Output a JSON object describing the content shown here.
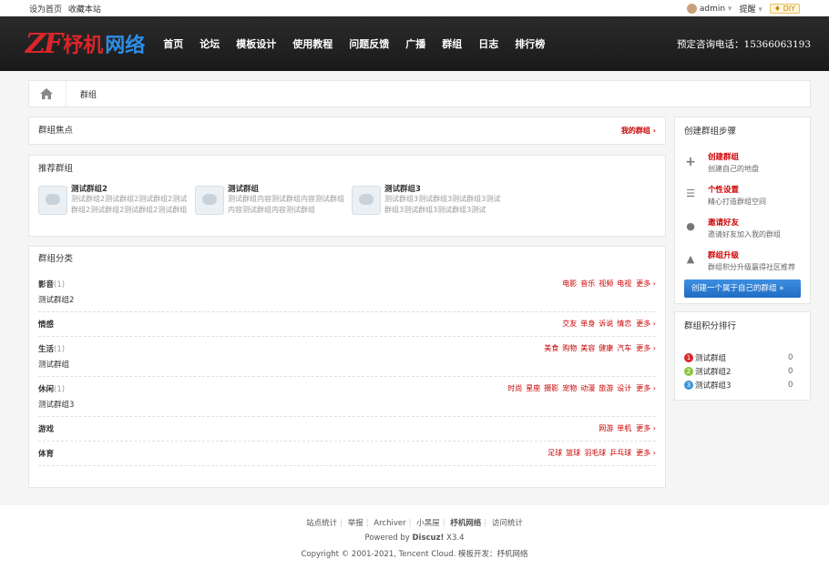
{
  "topbar": {
    "set_home": "设为首页",
    "bookmark": "收藏本站",
    "user": "admin",
    "remind": "提醒",
    "diy": "DIY"
  },
  "header": {
    "logo_letters": "ZF",
    "logo_text1": "杼机",
    "logo_text2": "网络",
    "nav": [
      "首页",
      "论坛",
      "模板设计",
      "使用教程",
      "问题反馈",
      "广播",
      "群组",
      "日志",
      "排行榜"
    ],
    "hotline": "预定咨询电话：15366063193"
  },
  "breadcrumb": {
    "current": "群组"
  },
  "focus": {
    "title": "群组焦点",
    "my_groups": "我的群组 ›"
  },
  "recommend": {
    "title": "推荐群组",
    "groups": [
      {
        "name": "测试群组2",
        "desc": "测试群组2测试群组2测试群组2测试群组2测试群组2测试群组2测试群组2"
      },
      {
        "name": "测试群组",
        "desc": "测试群组内容测试群组内容测试群组内容测试群组内容测试群组"
      },
      {
        "name": "测试群组3",
        "desc": "测试群组3测试群组3测试群组3测试群组3测试群组3测试群组3测试"
      }
    ]
  },
  "categories": {
    "title": "群组分类",
    "items": [
      {
        "name": "影音",
        "count": "(1)",
        "links": [
          "电影",
          "音乐",
          "视频",
          "电视"
        ],
        "more": "更多 ›",
        "sub": "测试群组2"
      },
      {
        "name": "情感",
        "count": "",
        "links": [
          "交友",
          "单身",
          "诉说",
          "情恋"
        ],
        "more": "更多 ›",
        "sub": ""
      },
      {
        "name": "生活",
        "count": "(1)",
        "links": [
          "美食",
          "购物",
          "美容",
          "健康",
          "汽车"
        ],
        "more": "更多 ›",
        "sub": "测试群组"
      },
      {
        "name": "休闲",
        "count": "(1)",
        "links": [
          "时尚",
          "星座",
          "摄影",
          "宠物",
          "动漫",
          "旅游",
          "设计"
        ],
        "more": "更多 ›",
        "sub": "测试群组3"
      },
      {
        "name": "游戏",
        "count": "",
        "links": [
          "网游",
          "单机"
        ],
        "more": "更多 ›",
        "sub": ""
      },
      {
        "name": "体育",
        "count": "",
        "links": [
          "足球",
          "篮球",
          "羽毛球",
          "乒乓球"
        ],
        "more": "更多 ›",
        "sub": ""
      }
    ]
  },
  "steps": {
    "title": "创建群组步骤",
    "items": [
      {
        "icon": "plus-icon",
        "title": "创建群组",
        "desc": "创建自己的地盘"
      },
      {
        "icon": "list-icon",
        "title": "个性设置",
        "desc": "精心打造群组空间"
      },
      {
        "icon": "user-icon",
        "title": "邀请好友",
        "desc": "邀请好友加入我的群组"
      },
      {
        "icon": "arrow-up-icon",
        "title": "群组升级",
        "desc": "群组积分升级赢得社区推荐"
      }
    ],
    "button": "创建一个属于自己的群组 »"
  },
  "ranking": {
    "title": "群组积分排行",
    "items": [
      {
        "no": "1",
        "name": "测试群组",
        "value": "0",
        "color": "#d9262b"
      },
      {
        "no": "2",
        "name": "测试群组2",
        "value": "0",
        "color": "#8cc63f"
      },
      {
        "no": "3",
        "name": "测试群组3",
        "value": "0",
        "color": "#3a95d8"
      }
    ]
  },
  "footer": {
    "links": [
      "站点统计",
      "举报",
      "Archiver",
      "小黑屋",
      "杼机网络",
      "访问统计"
    ],
    "powered_prefix": "Powered by ",
    "powered_brand": "Discuz!",
    "powered_version": " X3.4",
    "copyright": "Copyright © 2001-2021, Tencent Cloud. 模板开发：杼机网络"
  },
  "colors": {
    "accent": "#cc0000",
    "header_bg": "#1f1f1f",
    "button_blue": "#2a7bd2"
  }
}
